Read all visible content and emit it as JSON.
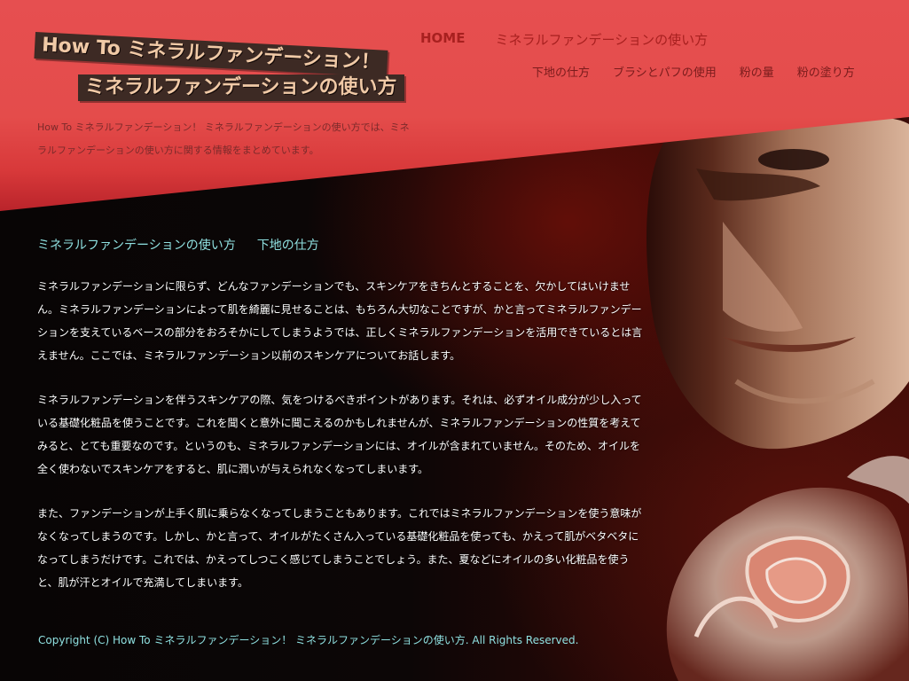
{
  "logo": {
    "line1": "How To ミネラルファンデーション！",
    "line2": "ミネラルファンデーションの使い方"
  },
  "site_description": "How To ミネラルファンデーション！ ミネラルファンデーションの使い方では、ミネラルファンデーションの使い方に関する情報をまとめています。",
  "nav": {
    "main": [
      "HOME",
      "ミネラルファンデーションの使い方"
    ],
    "sub": [
      "下地の仕方",
      "ブラシとパフの使用",
      "粉の量",
      "粉の塗り方"
    ]
  },
  "breadcrumb": [
    "ミネラルファンデーションの使い方",
    "下地の仕方"
  ],
  "article": {
    "paragraphs": [
      "ミネラルファンデーションに限らず、どんなファンデーションでも、スキンケアをきちんとすることを、欠かしてはいけません。ミネラルファンデーションによって肌を綺麗に見せることは、もちろん大切なことですが、かと言ってミネラルファンデーションを支えているベースの部分をおろそかにしてしまうようでは、正しくミネラルファンデーションを活用できているとは言えません。ここでは、ミネラルファンデーション以前のスキンケアについてお話します。",
      "ミネラルファンデーションを伴うスキンケアの際、気をつけるべきポイントがあります。それは、必ずオイル成分が少し入っている基礎化粧品を使うことです。これを聞くと意外に聞こえるのかもしれませんが、ミネラルファンデーションの性質を考えてみると、とても重要なのです。というのも、ミネラルファンデーションには、オイルが含まれていません。そのため、オイルを全く使わないでスキンケアをすると、肌に潤いが与えられなくなってしまいます。",
      "また、ファンデーションが上手く肌に乗らなくなってしまうこともあります。これではミネラルファンデーションを使う意味がなくなってしまうのです。しかし、かと言って、オイルがたくさん入っている基礎化粧品を使っても、かえって肌がベタベタになってしまうだけです。これでは、かえってしつこく感じてしまうことでしょう。また、夏などにオイルの多い化粧品を使うと、肌が汗とオイルで充満してしまいます。"
    ]
  },
  "footer": "Copyright (C) How To ミネラルファンデーション！ ミネラルファンデーションの使い方. All Rights Reserved.",
  "colors": {
    "header_red": "#e44c4b",
    "nav_red": "#a8201f",
    "accent_cyan": "#8fe0e0",
    "logo_bg": "#3d2a24"
  }
}
